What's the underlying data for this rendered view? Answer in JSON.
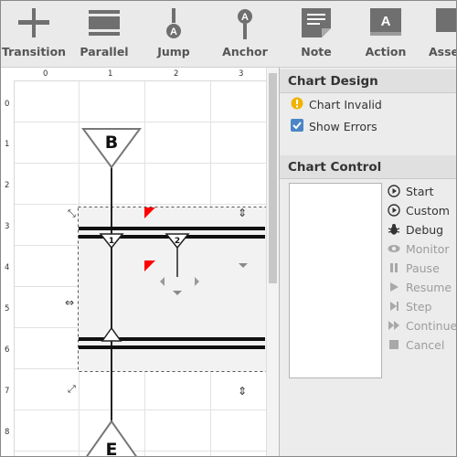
{
  "toolbar": {
    "items": [
      {
        "label": "Transition",
        "icon": "transition-icon"
      },
      {
        "label": "Parallel",
        "icon": "parallel-icon"
      },
      {
        "label": "Jump",
        "icon": "jump-icon",
        "glyph": "A"
      },
      {
        "label": "Anchor",
        "icon": "anchor-icon",
        "glyph": "A"
      },
      {
        "label": "Note",
        "icon": "note-icon"
      },
      {
        "label": "Action",
        "icon": "action-icon",
        "glyph": "A"
      },
      {
        "label": "Assert",
        "icon": "assert-icon"
      }
    ]
  },
  "canvas": {
    "ruler_top": [
      "0",
      "1",
      "2",
      "3"
    ],
    "ruler_left": [
      "0",
      "1",
      "2",
      "3",
      "4",
      "5",
      "6",
      "7",
      "8"
    ],
    "begin_label": "B",
    "end_label": "E",
    "parallel_labels": [
      "1",
      "2"
    ]
  },
  "chart_design": {
    "title": "Chart Design",
    "invalid_label": "Chart Invalid",
    "show_errors_label": "Show Errors",
    "show_errors_checked": true
  },
  "chart_control": {
    "title": "Chart Control",
    "buttons": [
      {
        "label": "Start",
        "icon": "play-icon",
        "enabled": true
      },
      {
        "label": "Custom",
        "icon": "play-icon",
        "enabled": true
      },
      {
        "label": "Debug",
        "icon": "bug-icon",
        "enabled": true
      },
      {
        "label": "Monitor",
        "icon": "eye-icon",
        "enabled": false
      },
      {
        "label": "Pause",
        "icon": "pause-icon",
        "enabled": false
      },
      {
        "label": "Resume",
        "icon": "resume-icon",
        "enabled": false
      },
      {
        "label": "Step",
        "icon": "step-icon",
        "enabled": false
      },
      {
        "label": "Continue",
        "icon": "continue-icon",
        "enabled": false
      },
      {
        "label": "Cancel",
        "icon": "stop-icon",
        "enabled": false
      }
    ]
  },
  "colors": {
    "accent": "#4a86c6",
    "warning": "#f0b400",
    "error": "#ff0000",
    "icon_gray": "#6f6f6f"
  }
}
